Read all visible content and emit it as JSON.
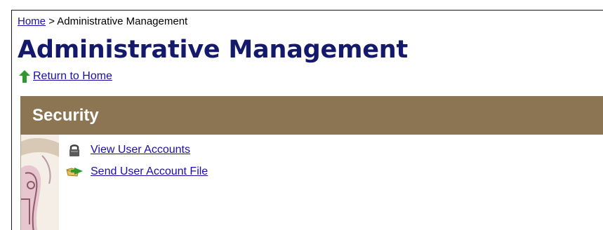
{
  "breadcrumb": {
    "home_label": "Home",
    "separator": ">",
    "current": "Administrative Management"
  },
  "page": {
    "title": "Administrative Management",
    "return_label": "Return to Home"
  },
  "section": {
    "title": "Security",
    "links": [
      {
        "label": "View User Accounts",
        "icon": "lock-icon"
      },
      {
        "label": "Send User Account File",
        "icon": "send-file-icon"
      }
    ]
  },
  "colors": {
    "title": "#14196b",
    "link": "#1a0dab",
    "section_header_bg": "#8b7553",
    "arrow": "#2e9a2e"
  }
}
